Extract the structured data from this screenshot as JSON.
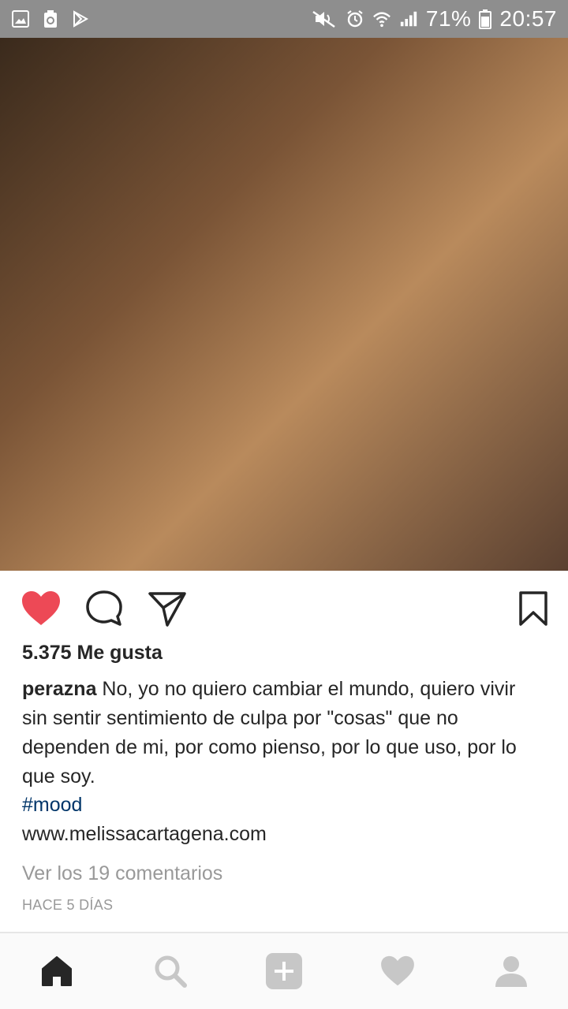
{
  "status_bar": {
    "battery": "71%",
    "time": "20:57",
    "background": "#8e8e8e"
  },
  "post": {
    "image_placeholder_note": "",
    "likes": "5.375 Me gusta",
    "username": "perazna",
    "caption": " No, yo no quiero cambiar el mundo, quiero vivir sin sentir sentimiento de culpa por \"cosas\" que no dependen de mi, por como pienso, por lo que uso, por lo que soy.",
    "hashtag": "#mood",
    "website": "www.melissacartagena.com",
    "comments_link": "Ver los 19 comentarios",
    "timestamp": "HACE 5 DÍAS"
  },
  "colors": {
    "like_red": "#ed4956",
    "hashtag_blue": "#003569",
    "muted_gray": "#999999",
    "icon_dark": "#262626",
    "nav_inactive": "#c7c7c7"
  },
  "icons": {
    "actions": [
      "heart-filled-icon",
      "comment-icon",
      "share-icon",
      "bookmark-icon"
    ],
    "nav": [
      "home-icon",
      "search-icon",
      "add-icon",
      "activity-heart-icon",
      "profile-icon"
    ]
  }
}
